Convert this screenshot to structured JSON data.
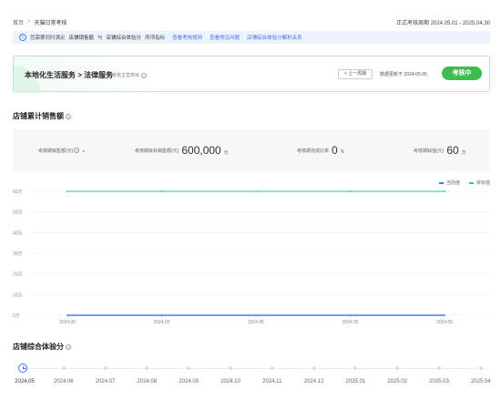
{
  "breadcrumb": {
    "home": "首页",
    "separator": ">",
    "current": "天猫日常考核"
  },
  "period": "正式考核周期 2024.05.01 - 2025.04.30",
  "notice": {
    "text_prefix": "您需要同时满足",
    "bold1": "店铺销售额",
    "text_mid": "与",
    "bold2": "店铺综合体验分",
    "text_suffix": "两项指标",
    "links": [
      "查看考核规则",
      "查看常见问题",
      "店铺综合体验分解析关系"
    ]
  },
  "service": {
    "title": "本地化生活服务 > 法律服务",
    "subtitle": "考核主营类目",
    "prev_button": "< 上一周期",
    "updated": "数据更新于 2024-05-05",
    "status": "考核中"
  },
  "sales_section_title": "店铺累计销售额",
  "metrics": [
    {
      "label": "考核期销售额(元)",
      "value": "",
      "unit": "",
      "dash": "-"
    },
    {
      "label": "考核期目标销售额(元)",
      "value": "600,000",
      "unit": "元"
    },
    {
      "label": "考核期完成比率",
      "value": "0",
      "unit": "%"
    },
    {
      "label": "考核期缺值(元)",
      "value": "60",
      "unit": "万"
    }
  ],
  "chart_data": {
    "type": "line",
    "x": [
      "2024.05",
      "2024.05",
      "2024.05",
      "2024.05",
      "2024.05"
    ],
    "ylim": [
      0,
      60
    ],
    "yticks": [
      "0万",
      "10万",
      "20万",
      "30万",
      "40万",
      "50万",
      "60万"
    ],
    "series": [
      {
        "name": "当前值",
        "values": [
          0,
          0,
          0,
          0,
          0
        ],
        "color": "#4a7fe0"
      },
      {
        "name": "目标值",
        "values": [
          60,
          60,
          60,
          60,
          60
        ],
        "color": "#2bc3a0"
      }
    ],
    "grid": true,
    "legend": "top-right"
  },
  "score_section_title": "店铺综合体验分",
  "timeline": {
    "months": [
      "2024.05",
      "2024.06",
      "2024.07",
      "2024.08",
      "2024.09",
      "2024.10",
      "2024.11",
      "2024.12",
      "2025.01",
      "2025.02",
      "2025.03",
      "2025.04"
    ],
    "active_index": 0
  },
  "colors": {
    "accent": "#3b73e6",
    "status_green": "#3cbd4d",
    "target_line": "#2bc3a0",
    "current_line": "#4a7fe0"
  }
}
